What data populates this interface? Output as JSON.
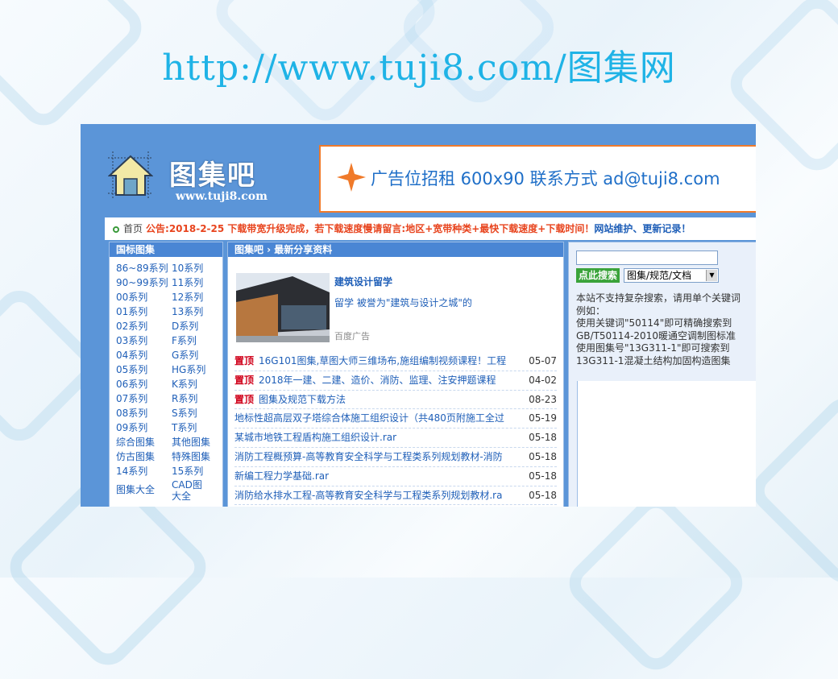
{
  "headline": "http://www.tuji8.com/图集网",
  "site": {
    "logo_title": "图集吧",
    "logo_url": "www.tuji8.com",
    "ad_text": "广告位招租 600x90  联系方式 ad@tuji8.com"
  },
  "notice": {
    "home": "首页",
    "bulletin": "公告:2018-2-25 下载带宽升级完成，若下载速度慢请留言:地区+宽带种类+最快下载速度+下载时间！",
    "maintenance": "网站维护、更新记录！"
  },
  "left_panel": {
    "title": "国标图集",
    "items": [
      "86~89系列",
      "10系列",
      "90~99系列",
      "11系列",
      "00系列",
      "12系列",
      "01系列",
      "13系列",
      "02系列",
      "D系列",
      "03系列",
      "F系列",
      "04系列",
      "G系列",
      "05系列",
      "HG系列",
      "06系列",
      "K系列",
      "07系列",
      "R系列",
      "08系列",
      "S系列",
      "09系列",
      "T系列",
      "综合图集",
      "其他图集",
      "仿古图集",
      "特殊图集",
      "14系列",
      "15系列",
      "图集大全",
      "CAD图大全"
    ]
  },
  "mid_panel": {
    "title": "图集吧 › 最新分享资料",
    "featured": {
      "title": "建筑设计留学",
      "desc": "留学 被誉为\"建筑与设计之城\"的",
      "source": "百度广告"
    },
    "news": [
      {
        "pin": "置顶",
        "title": "16G101图集,草图大师三维场布,施组编制视频课程！工程",
        "date": "05-07"
      },
      {
        "pin": "置顶",
        "title": "2018年一建、二建、造价、消防、监理、注安押题课程",
        "date": "04-02"
      },
      {
        "pin": "置顶",
        "title": "图集及规范下载方法",
        "date": "08-23"
      },
      {
        "pin": "",
        "title": "地标性超高层双子塔综合体施工组织设计（共480页附施工全过",
        "date": "05-19"
      },
      {
        "pin": "",
        "title": "某城市地铁工程盾构施工组织设计.rar",
        "date": "05-18"
      },
      {
        "pin": "",
        "title": "消防工程概预算-高等教育安全科学与工程类系列规划教材-消防",
        "date": "05-18"
      },
      {
        "pin": "",
        "title": "新编工程力学基础.rar",
        "date": "05-18"
      },
      {
        "pin": "",
        "title": "消防给水排水工程-高等教育安全科学与工程类系列规划教材.ra",
        "date": "05-18"
      }
    ]
  },
  "right_panel": {
    "search_button": "点此搜索",
    "search_type": "图集/规范/文档",
    "tips": [
      "本站不支持复杂搜索，请用单个关键词",
      "例如：",
      "使用关键词\"50114\"即可精确搜索到",
      "GB/T50114-2010暖通空调制图标准",
      "使用图集号\"13G311-1\"即可搜索到",
      "13G311-1混凝土结构加固构造图集"
    ]
  }
}
